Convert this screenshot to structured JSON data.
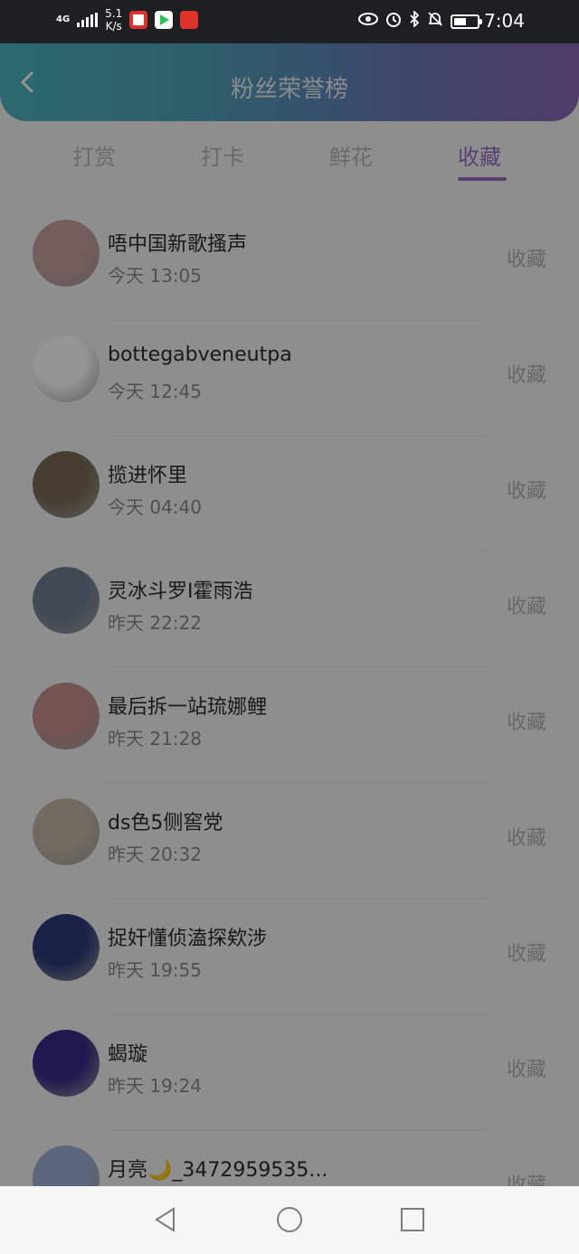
{
  "status_bar": {
    "network": "4G",
    "net_speed": "5.1\nK/s",
    "time": "7:04",
    "battery_level": 0.55,
    "icons": [
      "eye-comfort-icon",
      "alarm-icon",
      "bluetooth-icon",
      "mute-icon"
    ]
  },
  "header": {
    "title": "粉丝荣誉榜",
    "back_icon": "chevron-left-icon",
    "gradient": [
      "#4fb6c0",
      "#8a68b6"
    ]
  },
  "tabs": [
    {
      "label": "打赏",
      "active": false
    },
    {
      "label": "打卡",
      "active": false
    },
    {
      "label": "鲜花",
      "active": false
    },
    {
      "label": "收藏",
      "active": true
    }
  ],
  "accent_color": "#9b6fc3",
  "list": [
    {
      "name": "唔中国新歌搔声",
      "time": "今天 13:05",
      "action": "收藏",
      "avatar_color": "#c9a0a0"
    },
    {
      "name": "bottegabveneutpa",
      "time": "今天 12:45",
      "action": "收藏",
      "avatar_color": "#ffffff"
    },
    {
      "name": "揽进怀里",
      "time": "今天 04:40",
      "action": "收藏",
      "avatar_color": "#7a6b55"
    },
    {
      "name": "灵冰斗罗I霍雨浩",
      "time": "昨天 22:22",
      "action": "收藏",
      "avatar_color": "#6f7f92"
    },
    {
      "name": "最后拆一站琉娜鲤",
      "time": "昨天 21:28",
      "action": "收藏",
      "avatar_color": "#c98f8f"
    },
    {
      "name": "ds色5侧窖党",
      "time": "昨天 20:32",
      "action": "收藏",
      "avatar_color": "#c6b8a8"
    },
    {
      "name": "捉奸懂侦溘探欸涉",
      "time": "昨天 19:55",
      "action": "收藏",
      "avatar_color": "#2c3a7a"
    },
    {
      "name": "蝎璇",
      "time": "昨天 19:24",
      "action": "收藏",
      "avatar_color": "#3b2a8a"
    },
    {
      "name": "月亮🌙_3472959535...",
      "time": "",
      "action": "收藏",
      "avatar_color": "#9fb0d8"
    }
  ],
  "nav_bar": {
    "buttons": [
      "back-triangle-icon",
      "home-circle-icon",
      "recents-square-icon"
    ]
  }
}
